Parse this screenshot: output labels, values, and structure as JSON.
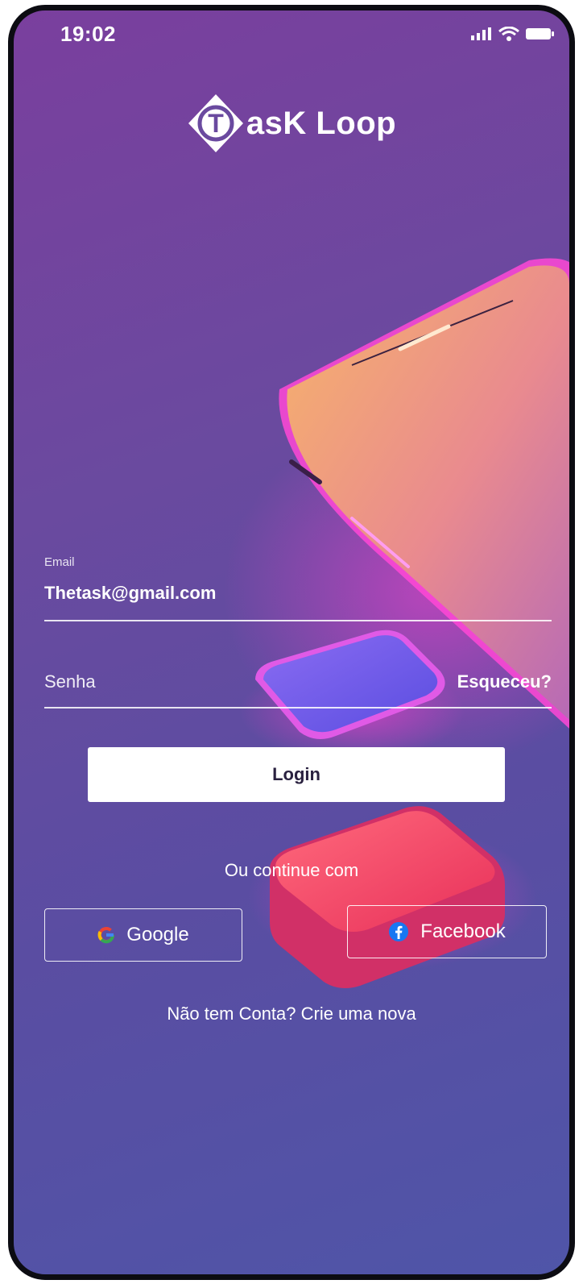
{
  "status_bar": {
    "time": "19:02",
    "icons": [
      "signal-icon",
      "wifi-icon",
      "battery-icon"
    ]
  },
  "brand": {
    "logo_letter": "T",
    "name": "asK Loop"
  },
  "form": {
    "email_label": "Email",
    "email_value": "Thetask@gmail.com",
    "password_placeholder": "Senha",
    "forgot_link": "Esqueceu?",
    "login_button": "Login"
  },
  "social": {
    "divider": "Ou continue com",
    "google_label": "Google",
    "facebook_label": "Facebook"
  },
  "footer": {
    "signup_text": "Não tem Conta? Crie uma nova"
  },
  "colors": {
    "background_start": "#7a3f9e",
    "background_end": "#4f55a8",
    "button_bg": "#ffffff",
    "button_text": "#2a2140",
    "text": "#ffffff"
  }
}
